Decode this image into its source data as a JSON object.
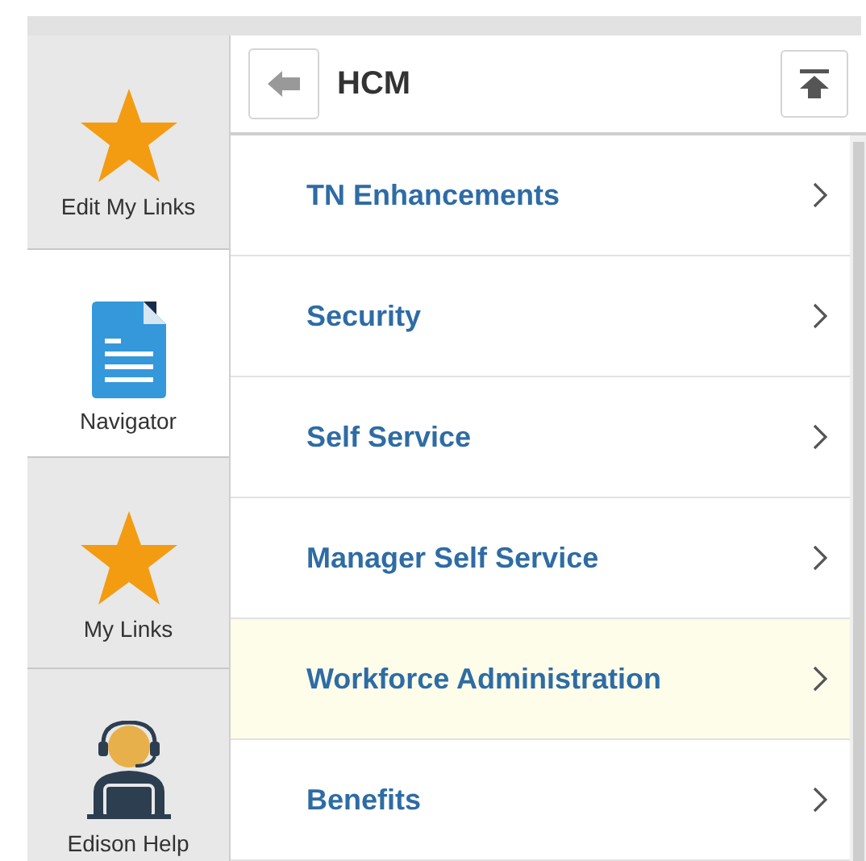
{
  "sidebar": {
    "items": [
      {
        "label": "Edit My Links",
        "kind": "star",
        "selected": false
      },
      {
        "label": "Navigator",
        "kind": "document",
        "selected": true
      },
      {
        "label": "My Links",
        "kind": "star",
        "selected": false
      },
      {
        "label": "Edison Help",
        "kind": "agent",
        "selected": false
      }
    ]
  },
  "header": {
    "title": "HCM"
  },
  "menu": {
    "items": [
      {
        "label": "TN Enhancements",
        "highlighted": false
      },
      {
        "label": "Security",
        "highlighted": false
      },
      {
        "label": "Self Service",
        "highlighted": false
      },
      {
        "label": "Manager Self Service",
        "highlighted": false
      },
      {
        "label": "Workforce Administration",
        "highlighted": true
      },
      {
        "label": "Benefits",
        "highlighted": false
      }
    ]
  }
}
